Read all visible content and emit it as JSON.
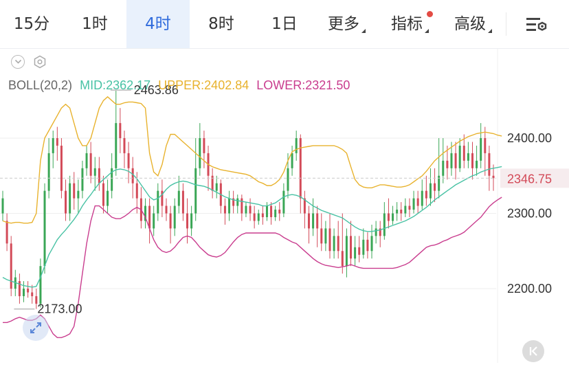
{
  "tabs": [
    {
      "label": "15分",
      "active": false,
      "dropdown": false
    },
    {
      "label": "1时",
      "active": false,
      "dropdown": false
    },
    {
      "label": "4时",
      "active": true,
      "dropdown": false
    },
    {
      "label": "8时",
      "active": false,
      "dropdown": false
    },
    {
      "label": "1日",
      "active": false,
      "dropdown": false
    },
    {
      "label": "更多",
      "active": false,
      "dropdown": true
    },
    {
      "label": "指标",
      "active": false,
      "dropdown": true,
      "badge": true
    },
    {
      "label": "高级",
      "active": false,
      "dropdown": true
    }
  ],
  "toolbar": {
    "settings_icon": "chart-settings-icon",
    "collapse_icon": "chevron-down-icon",
    "gear_icon": "hexagon-gear-icon"
  },
  "legend": {
    "name": "BOLL(20,2)",
    "mid": "MID:2362.17",
    "upper": "UPPER:2402.84",
    "lower": "LOWER:2321.50"
  },
  "colors": {
    "up": "#3aa655",
    "down": "#d34a58",
    "mid": "#48c2a4",
    "upper": "#e8b22d",
    "lower": "#c93c8e",
    "accent": "#2f6bdc",
    "current_price_bg": "#f6ecee",
    "current_price_text": "#d34a58"
  },
  "chart_data": {
    "type": "candlestick",
    "ylim": [
      2140,
      2480
    ],
    "y_ticks": [
      {
        "value": 2400,
        "label": "2400.00"
      },
      {
        "value": 2300,
        "label": "2300.00"
      },
      {
        "value": 2200,
        "label": "2200.00"
      }
    ],
    "current_price": {
      "value": 2346.75,
      "label": "2346.75"
    },
    "annotations": [
      {
        "label": "2463.86",
        "value": 2463.86,
        "index": 27
      },
      {
        "label": "2173.00",
        "value": 2173,
        "index": 4
      }
    ],
    "candles": [
      [
        2300,
        2320,
        2290,
        2330
      ],
      [
        2290,
        2260,
        2250,
        2300
      ],
      [
        2260,
        2200,
        2190,
        2270
      ],
      [
        2200,
        2215,
        2190,
        2225
      ],
      [
        2210,
        2190,
        2180,
        2220
      ],
      [
        2190,
        2200,
        2182,
        2210
      ],
      [
        2200,
        2195,
        2188,
        2210
      ],
      [
        2195,
        2190,
        2180,
        2205
      ],
      [
        2190,
        2180,
        2173,
        2200
      ],
      [
        2180,
        2230,
        2175,
        2240
      ],
      [
        2230,
        2330,
        2220,
        2340
      ],
      [
        2330,
        2380,
        2320,
        2400
      ],
      [
        2380,
        2400,
        2360,
        2410
      ],
      [
        2400,
        2390,
        2370,
        2415
      ],
      [
        2390,
        2330,
        2320,
        2400
      ],
      [
        2330,
        2300,
        2290,
        2345
      ],
      [
        2300,
        2340,
        2290,
        2350
      ],
      [
        2340,
        2320,
        2305,
        2355
      ],
      [
        2320,
        2330,
        2300,
        2345
      ],
      [
        2330,
        2360,
        2320,
        2370
      ],
      [
        2360,
        2380,
        2350,
        2390
      ],
      [
        2380,
        2350,
        2340,
        2395
      ],
      [
        2350,
        2360,
        2330,
        2375
      ],
      [
        2360,
        2340,
        2330,
        2375
      ],
      [
        2340,
        2310,
        2300,
        2350
      ],
      [
        2310,
        2330,
        2300,
        2345
      ],
      [
        2330,
        2360,
        2320,
        2380
      ],
      [
        2360,
        2420,
        2350,
        2463
      ],
      [
        2420,
        2400,
        2380,
        2440
      ],
      [
        2400,
        2380,
        2360,
        2410
      ],
      [
        2380,
        2360,
        2340,
        2395
      ],
      [
        2360,
        2340,
        2320,
        2375
      ],
      [
        2340,
        2320,
        2300,
        2355
      ],
      [
        2320,
        2290,
        2280,
        2335
      ],
      [
        2290,
        2310,
        2280,
        2320
      ],
      [
        2310,
        2280,
        2260,
        2320
      ],
      [
        2280,
        2300,
        2270,
        2310
      ],
      [
        2300,
        2330,
        2290,
        2340
      ],
      [
        2330,
        2310,
        2295,
        2345
      ],
      [
        2310,
        2300,
        2290,
        2320
      ],
      [
        2300,
        2280,
        2260,
        2310
      ],
      [
        2280,
        2310,
        2270,
        2320
      ],
      [
        2310,
        2330,
        2300,
        2350
      ],
      [
        2330,
        2300,
        2290,
        2340
      ],
      [
        2300,
        2280,
        2260,
        2320
      ],
      [
        2280,
        2300,
        2270,
        2310
      ],
      [
        2300,
        2360,
        2290,
        2400
      ],
      [
        2360,
        2400,
        2350,
        2420
      ],
      [
        2400,
        2380,
        2360,
        2410
      ],
      [
        2380,
        2350,
        2330,
        2390
      ],
      [
        2350,
        2330,
        2320,
        2360
      ],
      [
        2330,
        2340,
        2320,
        2350
      ],
      [
        2340,
        2310,
        2300,
        2345
      ],
      [
        2310,
        2300,
        2285,
        2320
      ],
      [
        2300,
        2320,
        2290,
        2330
      ],
      [
        2320,
        2310,
        2300,
        2330
      ],
      [
        2310,
        2320,
        2300,
        2325
      ],
      [
        2320,
        2300,
        2290,
        2325
      ],
      [
        2300,
        2310,
        2295,
        2315
      ],
      [
        2310,
        2300,
        2290,
        2320
      ],
      [
        2300,
        2290,
        2280,
        2310
      ],
      [
        2290,
        2300,
        2285,
        2305
      ],
      [
        2300,
        2295,
        2285,
        2310
      ],
      [
        2295,
        2310,
        2290,
        2315
      ],
      [
        2310,
        2295,
        2285,
        2315
      ],
      [
        2295,
        2305,
        2290,
        2310
      ],
      [
        2305,
        2300,
        2290,
        2315
      ],
      [
        2300,
        2330,
        2295,
        2340
      ],
      [
        2330,
        2360,
        2320,
        2380
      ],
      [
        2360,
        2380,
        2350,
        2390
      ],
      [
        2380,
        2400,
        2370,
        2410
      ],
      [
        2400,
        2320,
        2300,
        2405
      ],
      [
        2320,
        2300,
        2280,
        2330
      ],
      [
        2300,
        2280,
        2260,
        2310
      ],
      [
        2280,
        2300,
        2270,
        2320
      ],
      [
        2300,
        2280,
        2255,
        2310
      ],
      [
        2280,
        2260,
        2250,
        2300
      ],
      [
        2260,
        2280,
        2250,
        2290
      ],
      [
        2280,
        2250,
        2240,
        2300
      ],
      [
        2250,
        2270,
        2240,
        2280
      ],
      [
        2270,
        2250,
        2240,
        2290
      ],
      [
        2250,
        2230,
        2220,
        2300
      ],
      [
        2230,
        2270,
        2215,
        2280
      ],
      [
        2270,
        2240,
        2230,
        2290
      ],
      [
        2240,
        2255,
        2230,
        2270
      ],
      [
        2255,
        2245,
        2235,
        2270
      ],
      [
        2245,
        2265,
        2240,
        2280
      ],
      [
        2265,
        2250,
        2240,
        2275
      ],
      [
        2250,
        2270,
        2240,
        2285
      ],
      [
        2270,
        2280,
        2260,
        2290
      ],
      [
        2280,
        2270,
        2255,
        2290
      ],
      [
        2270,
        2300,
        2265,
        2315
      ],
      [
        2300,
        2290,
        2280,
        2320
      ],
      [
        2290,
        2300,
        2285,
        2310
      ],
      [
        2300,
        2305,
        2290,
        2315
      ],
      [
        2305,
        2300,
        2290,
        2315
      ],
      [
        2300,
        2310,
        2295,
        2320
      ],
      [
        2310,
        2305,
        2295,
        2320
      ],
      [
        2305,
        2320,
        2300,
        2330
      ],
      [
        2320,
        2310,
        2300,
        2330
      ],
      [
        2310,
        2330,
        2305,
        2345
      ],
      [
        2330,
        2320,
        2310,
        2350
      ],
      [
        2320,
        2340,
        2310,
        2360
      ],
      [
        2340,
        2330,
        2315,
        2360
      ],
      [
        2330,
        2350,
        2320,
        2400
      ],
      [
        2350,
        2370,
        2340,
        2400
      ],
      [
        2370,
        2360,
        2345,
        2390
      ],
      [
        2360,
        2380,
        2350,
        2395
      ],
      [
        2380,
        2360,
        2345,
        2395
      ],
      [
        2360,
        2390,
        2355,
        2400
      ],
      [
        2390,
        2370,
        2360,
        2405
      ],
      [
        2370,
        2380,
        2360,
        2395
      ],
      [
        2380,
        2360,
        2345,
        2395
      ],
      [
        2360,
        2370,
        2350,
        2390
      ],
      [
        2370,
        2400,
        2360,
        2420
      ],
      [
        2400,
        2380,
        2350,
        2415
      ],
      [
        2380,
        2350,
        2330,
        2390
      ],
      [
        2350,
        2346.75,
        2330,
        2365
      ]
    ],
    "series": [
      {
        "key": "upper",
        "values": [
          2290,
          2288,
          2287,
          2288,
          2288,
          2287,
          2287,
          2288,
          2300,
          2370,
          2400,
          2410,
          2420,
          2430,
          2440,
          2445,
          2440,
          2420,
          2400,
          2390,
          2390,
          2400,
          2420,
          2440,
          2450,
          2455,
          2450,
          2445,
          2445,
          2447,
          2448,
          2448,
          2447,
          2446,
          2440,
          2380,
          2355,
          2350,
          2365,
          2390,
          2405,
          2405,
          2400,
          2395,
          2390,
          2385,
          2380,
          2375,
          2370,
          2365,
          2362,
          2360,
          2358,
          2357,
          2356,
          2355,
          2354,
          2353,
          2352,
          2350,
          2346,
          2342,
          2340,
          2337,
          2337,
          2340,
          2345,
          2355,
          2370,
          2382,
          2385,
          2387,
          2388,
          2389,
          2390,
          2390,
          2390,
          2390,
          2390,
          2390,
          2388,
          2385,
          2380,
          2362,
          2345,
          2338,
          2335,
          2334,
          2334,
          2336,
          2338,
          2338,
          2337,
          2336,
          2335,
          2335,
          2336,
          2338,
          2342,
          2346,
          2350,
          2356,
          2363,
          2370,
          2375,
          2380,
          2384,
          2388,
          2392,
          2396,
          2399,
          2402,
          2404,
          2406,
          2407,
          2408,
          2407,
          2406,
          2404,
          2402.84
        ]
      },
      {
        "key": "mid",
        "values": [
          2215,
          2212,
          2210,
          2208,
          2206,
          2204,
          2203,
          2202,
          2203,
          2215,
          2230,
          2245,
          2255,
          2265,
          2272,
          2278,
          2285,
          2292,
          2300,
          2310,
          2318,
          2325,
          2333,
          2340,
          2345,
          2350,
          2355,
          2358,
          2359,
          2358,
          2356,
          2352,
          2346,
          2338,
          2330,
          2322,
          2318,
          2320,
          2325,
          2332,
          2337,
          2340,
          2342,
          2343,
          2342,
          2340,
          2338,
          2337,
          2336,
          2334,
          2331,
          2328,
          2325,
          2322,
          2320,
          2318,
          2317,
          2316,
          2315,
          2314,
          2313,
          2312,
          2310,
          2310,
          2312,
          2314,
          2318,
          2322,
          2324,
          2325,
          2324,
          2322,
          2318,
          2314,
          2310,
          2307,
          2304,
          2302,
          2300,
          2298,
          2296,
          2294,
          2290,
          2286,
          2282,
          2279,
          2277,
          2276,
          2276,
          2277,
          2278,
          2280,
          2282,
          2284,
          2286,
          2288,
          2290,
          2293,
          2296,
          2300,
          2304,
          2308,
          2313,
          2318,
          2322,
          2326,
          2330,
          2334,
          2338,
          2341,
          2344,
          2347,
          2350,
          2352,
          2355,
          2357,
          2359,
          2360,
          2361,
          2362.17
        ]
      },
      {
        "key": "lower",
        "values": [
          2155,
          2155,
          2157,
          2160,
          2162,
          2160,
          2158,
          2158,
          2160,
          2165,
          2160,
          2150,
          2140,
          2135,
          2135,
          2137,
          2140,
          2150,
          2180,
          2220,
          2260,
          2290,
          2310,
          2310,
          2305,
          2300,
          2295,
          2293,
          2293,
          2296,
          2300,
          2305,
          2308,
          2305,
          2295,
          2280,
          2265,
          2255,
          2250,
          2248,
          2250,
          2255,
          2262,
          2268,
          2270,
          2268,
          2262,
          2255,
          2250,
          2245,
          2243,
          2242,
          2244,
          2248,
          2255,
          2262,
          2268,
          2272,
          2274,
          2274,
          2274,
          2274,
          2274,
          2274,
          2274,
          2274,
          2272,
          2268,
          2265,
          2262,
          2260,
          2255,
          2250,
          2245,
          2240,
          2236,
          2233,
          2231,
          2230,
          2229,
          2228,
          2229,
          2230,
          2232,
          2230,
          2228,
          2227,
          2227,
          2227,
          2227,
          2227,
          2227,
          2227,
          2227,
          2228,
          2230,
          2232,
          2235,
          2240,
          2245,
          2250,
          2255,
          2257,
          2258,
          2260,
          2263,
          2265,
          2268,
          2270,
          2272,
          2275,
          2280,
          2285,
          2290,
          2295,
          2302,
          2309,
          2314,
          2318,
          2321.5
        ]
      }
    ]
  }
}
